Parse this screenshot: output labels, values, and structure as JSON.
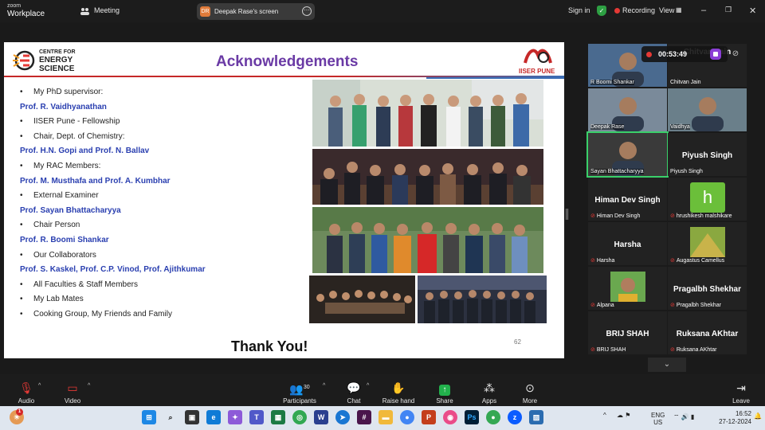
{
  "app": {
    "logo_line1": "zoom",
    "logo_line2": "Workplace",
    "meeting_label": "Meeting",
    "screen_initials": "DR",
    "screen_label": "Deepak Rase's screen",
    "sign_in": "Sign in",
    "recording": "Recording",
    "view": "View",
    "colors": {
      "accent": "#8b3fd6",
      "record": "#e53935",
      "shield": "#2ea043"
    }
  },
  "slide": {
    "title": "Acknowledgements",
    "ces_lines": [
      "CENTRE FOR",
      "ENERGY",
      "SCIENCE"
    ],
    "iiser_label": "IISER PUNE",
    "items": [
      {
        "kind": "bullet",
        "text": "My PhD supervisor:"
      },
      {
        "kind": "person",
        "text": "Prof. R. Vaidhyanathan"
      },
      {
        "kind": "bullet",
        "text": "IISER Pune - Fellowship"
      },
      {
        "kind": "bullet",
        "text": "Chair, Dept. of Chemistry:"
      },
      {
        "kind": "person",
        "text": "Prof. H.N. Gopi and Prof. N. Ballav"
      },
      {
        "kind": "bullet",
        "text": "My RAC Members:"
      },
      {
        "kind": "person",
        "text": "Prof. M. Musthafa and Prof. A. Kumbhar"
      },
      {
        "kind": "bullet",
        "text": "External Examiner"
      },
      {
        "kind": "person",
        "text": "Prof. Sayan Bhattacharyya"
      },
      {
        "kind": "bullet",
        "text": "Chair Person"
      },
      {
        "kind": "person",
        "text": "Prof. R. Boomi Shankar"
      },
      {
        "kind": "bullet",
        "text": "Our Collaborators"
      },
      {
        "kind": "person",
        "text": "Prof. S. Kaskel, Prof. C.P. Vinod, Prof. Ajithkumar"
      },
      {
        "kind": "bullet",
        "text": "All Faculties & Staff Members"
      },
      {
        "kind": "bullet",
        "text": "My Lab Mates"
      },
      {
        "kind": "bullet",
        "text": "Cooking Group, My Friends and Family"
      }
    ],
    "thanks": "Thank You!",
    "page_number": "62"
  },
  "meeting": {
    "timer": "00:53:49",
    "participants": [
      {
        "name": "R Boomi Shankar",
        "type": "video",
        "muted": false
      },
      {
        "name": "Chitvan Jain",
        "type": "name",
        "muted": false,
        "big": "Chitvan Jain"
      },
      {
        "name": "Deepak Rase",
        "type": "video",
        "muted": false
      },
      {
        "name": "Vaidhya",
        "type": "video",
        "muted": false
      },
      {
        "name": "Sayan Bhattacharyya",
        "type": "video",
        "muted": false,
        "active": true
      },
      {
        "name": "Piyush Singh",
        "type": "name",
        "muted": false,
        "big": "Piyush Singh"
      },
      {
        "name": "Himan Dev Singh",
        "type": "name",
        "muted": true,
        "big": "Himan Dev Singh"
      },
      {
        "name": "hrushikesh malshikare",
        "type": "avatar",
        "muted": true,
        "avatar_letter": "h"
      },
      {
        "name": "Harsha",
        "type": "name",
        "muted": true,
        "big": "Harsha"
      },
      {
        "name": "Augastus Camellus",
        "type": "avatar-img",
        "muted": true
      },
      {
        "name": "Alpana",
        "type": "avatar-img",
        "muted": true
      },
      {
        "name": "Pragalbh Shekhar",
        "type": "name",
        "muted": true,
        "big": "Pragalbh Shekhar"
      },
      {
        "name": "BRIJ SHAH",
        "type": "name",
        "muted": true,
        "big": "BRIJ SHAH"
      },
      {
        "name": "Ruksana AKhtar",
        "type": "name",
        "muted": true,
        "big": "Ruksana AKhtar"
      }
    ]
  },
  "toolbar": {
    "audio": "Audio",
    "video": "Video",
    "participants": "Participants",
    "participant_count": "30",
    "chat": "Chat",
    "raise_hand": "Raise hand",
    "share": "Share",
    "apps": "Apps",
    "more": "More",
    "leave": "Leave"
  },
  "taskbar": {
    "lang1": "ENG",
    "lang2": "US",
    "time": "16:52",
    "date": "27-12-2024",
    "notification_count": "1"
  }
}
